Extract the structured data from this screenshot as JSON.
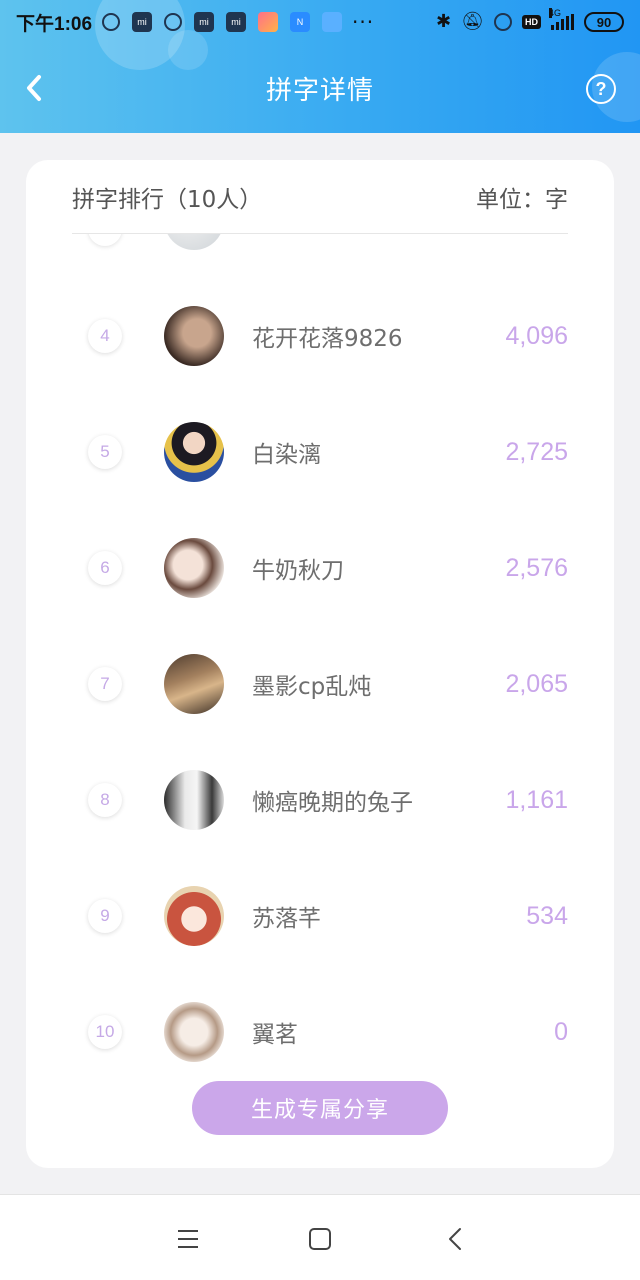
{
  "status_bar": {
    "time": "下午1:06",
    "network": "4G",
    "battery": "90",
    "hd_label": "HD"
  },
  "nav": {
    "title": "拼字详情"
  },
  "card": {
    "ranking_title": "拼字排行（10人）",
    "unit_label": "单位：字"
  },
  "ranking": [
    {
      "rank": "4",
      "name": "花开花落9826",
      "count": "4,096"
    },
    {
      "rank": "5",
      "name": "白染漓",
      "count": "2,725"
    },
    {
      "rank": "6",
      "name": "牛奶秋刀",
      "count": "2,576"
    },
    {
      "rank": "7",
      "name": "墨影cp乱炖",
      "count": "2,065"
    },
    {
      "rank": "8",
      "name": "懒癌晚期的兔子",
      "count": "1,161"
    },
    {
      "rank": "9",
      "name": "苏落芊",
      "count": "534"
    },
    {
      "rank": "10",
      "name": "翼茗",
      "count": "0"
    }
  ],
  "share_button": "生成专属分享",
  "colors": {
    "header_start": "#5ec3ee",
    "header_end": "#2196f3",
    "accent_purple": "#cba7ea",
    "count_text": "#c9a6ea"
  },
  "icons": {
    "back": "chevron-left-icon",
    "help": "question-circle-icon",
    "sys_menu": "menu-lines-icon",
    "sys_home": "square-home-icon",
    "sys_back": "chevron-left-icon"
  }
}
